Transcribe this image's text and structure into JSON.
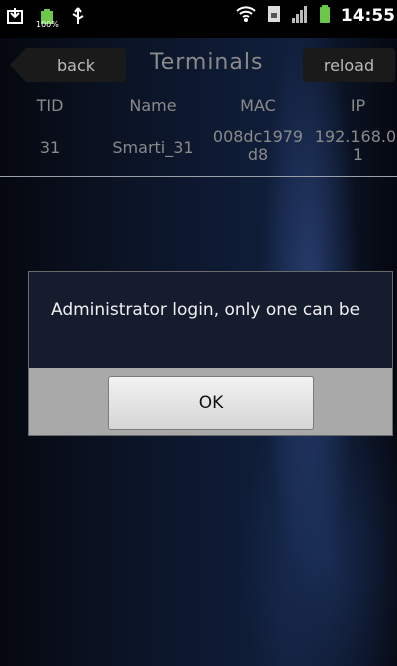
{
  "status_bar": {
    "time": "14:55",
    "battery_text": "100%",
    "icons": [
      "download-icon",
      "battery-icon",
      "usb-icon",
      "wifi-icon",
      "sim-icon",
      "signal-icon",
      "battery-icon"
    ]
  },
  "title_bar": {
    "back_label": "back",
    "title": "Terminals",
    "reload_label": "reload"
  },
  "table": {
    "headers": [
      "TID",
      "Name",
      "MAC",
      "IP"
    ],
    "rows": [
      [
        "31",
        "Smarti_31",
        "008dc1979\nd8",
        "192.168.0.\n1"
      ]
    ]
  },
  "dialog": {
    "message": "Administrator login, only one can be",
    "ok_label": "OK"
  },
  "colors": {
    "accent_dark": "#141c2e",
    "button_bar": "#a9a9a9",
    "text_muted": "#8a8a8a"
  }
}
